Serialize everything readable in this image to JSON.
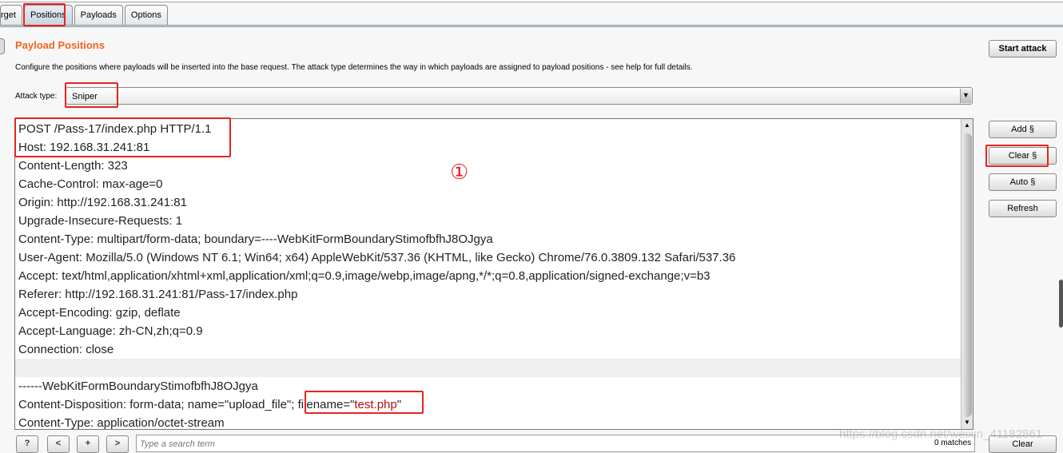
{
  "tabs": [
    {
      "label": "rget"
    },
    {
      "label": "Positions",
      "active": true
    },
    {
      "label": "Payloads"
    },
    {
      "label": "Options"
    }
  ],
  "section": {
    "title": "Payload Positions",
    "description": "Configure the positions where payloads will be inserted into the base request. The attack type determines the way in which payloads are assigned to payload positions - see help for full details."
  },
  "attack_type": {
    "label": "Attack type:",
    "value": "Sniper"
  },
  "request_lines": [
    "POST /Pass-17/index.php HTTP/1.1",
    "Host: 192.168.31.241:81",
    "Content-Length: 323",
    "Cache-Control: max-age=0",
    "Origin: http://192.168.31.241:81",
    "Upgrade-Insecure-Requests: 1",
    "Content-Type: multipart/form-data; boundary=----WebKitFormBoundaryStimofbfhJ8OJgya",
    "User-Agent: Mozilla/5.0 (Windows NT 6.1; Win64; x64) AppleWebKit/537.36 (KHTML, like Gecko) Chrome/76.0.3809.132 Safari/537.36",
    "Accept: text/html,application/xhtml+xml,application/xml;q=0.9,image/webp,image/apng,*/*;q=0.8,application/signed-exchange;v=b3",
    "Referer: http://192.168.31.241:81/Pass-17/index.php",
    "Accept-Encoding: gzip, deflate",
    "Accept-Language: zh-CN,zh;q=0.9",
    "Connection: close",
    "",
    "------WebKitFormBoundaryStimofbfhJ8OJgya"
  ],
  "disposition": {
    "prefix": "Content-Disposition: form-data; name=\"upload_file\"; filename=\"",
    "value": "test.php",
    "suffix": "\""
  },
  "last_line": "Content-Type: application/octet-stream",
  "annotation": "①",
  "buttons": {
    "start_attack": "Start attack",
    "add": "Add §",
    "clear_marker": "Clear §",
    "auto": "Auto §",
    "refresh": "Refresh",
    "clear": "Clear"
  },
  "search": {
    "help": "?",
    "prev": "<",
    "add": "+",
    "next": ">",
    "placeholder": "Type a search term",
    "matches": "0 matches"
  },
  "watermark": "https://blog.csdn.net/weixin_41182861",
  "colors": {
    "accent": "#f26522",
    "highlight": "#e8231f",
    "payload": "#b01010"
  }
}
